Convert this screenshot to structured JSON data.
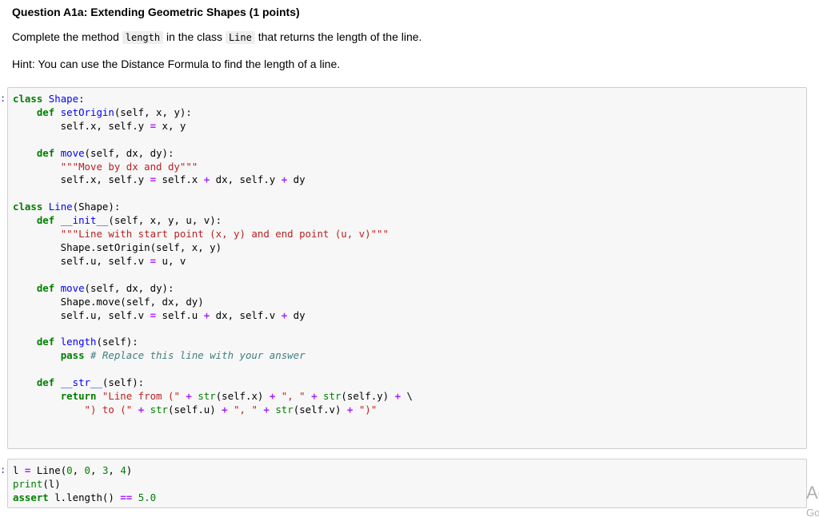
{
  "question": {
    "title": "Question A1a: Extending Geometric Shapes (1 points)",
    "instruction_prefix": "Complete the method ",
    "instruction_code1": "length",
    "instruction_middle": " in the class ",
    "instruction_code2": "Line",
    "instruction_suffix": " that returns the length of the line.",
    "hint": "Hint: You can use the Distance Formula to find the length of a line."
  },
  "cells": [
    {
      "prompt": ":",
      "lines": [
        [
          [
            "kw",
            "class"
          ],
          [
            "t",
            " "
          ],
          [
            "cls",
            "Shape"
          ],
          [
            "t",
            ":"
          ]
        ],
        [
          [
            "t",
            "    "
          ],
          [
            "kw",
            "def"
          ],
          [
            "t",
            " "
          ],
          [
            "fn",
            "setOrigin"
          ],
          [
            "t",
            "(self, x, y):"
          ]
        ],
        [
          [
            "t",
            "        self.x, self.y "
          ],
          [
            "op",
            "="
          ],
          [
            "t",
            " x, y"
          ]
        ],
        [
          [
            "t",
            ""
          ]
        ],
        [
          [
            "t",
            "    "
          ],
          [
            "kw",
            "def"
          ],
          [
            "t",
            " "
          ],
          [
            "fn",
            "move"
          ],
          [
            "t",
            "(self, dx, dy):"
          ]
        ],
        [
          [
            "t",
            "        "
          ],
          [
            "str",
            "\"\"\"Move by dx and dy\"\"\""
          ]
        ],
        [
          [
            "t",
            "        self.x, self.y "
          ],
          [
            "op",
            "="
          ],
          [
            "t",
            " self.x "
          ],
          [
            "op",
            "+"
          ],
          [
            "t",
            " dx, self.y "
          ],
          [
            "op",
            "+"
          ],
          [
            "t",
            " dy"
          ]
        ],
        [
          [
            "t",
            ""
          ]
        ],
        [
          [
            "kw",
            "class"
          ],
          [
            "t",
            " "
          ],
          [
            "cls",
            "Line"
          ],
          [
            "t",
            "(Shape):"
          ]
        ],
        [
          [
            "t",
            "    "
          ],
          [
            "kw",
            "def"
          ],
          [
            "t",
            " "
          ],
          [
            "fn",
            "__init__"
          ],
          [
            "t",
            "(self, x, y, u, v):"
          ]
        ],
        [
          [
            "t",
            "        "
          ],
          [
            "str",
            "\"\"\"Line with start point (x, y) and end point (u, v)\"\"\""
          ]
        ],
        [
          [
            "t",
            "        Shape.setOrigin(self, x, y)"
          ]
        ],
        [
          [
            "t",
            "        self.u, self.v "
          ],
          [
            "op",
            "="
          ],
          [
            "t",
            " u, v"
          ]
        ],
        [
          [
            "t",
            ""
          ]
        ],
        [
          [
            "t",
            "    "
          ],
          [
            "kw",
            "def"
          ],
          [
            "t",
            " "
          ],
          [
            "fn",
            "move"
          ],
          [
            "t",
            "(self, dx, dy):"
          ]
        ],
        [
          [
            "t",
            "        Shape.move(self, dx, dy)"
          ]
        ],
        [
          [
            "t",
            "        self.u, self.v "
          ],
          [
            "op",
            "="
          ],
          [
            "t",
            " self.u "
          ],
          [
            "op",
            "+"
          ],
          [
            "t",
            " dx, self.v "
          ],
          [
            "op",
            "+"
          ],
          [
            "t",
            " dy"
          ]
        ],
        [
          [
            "t",
            ""
          ]
        ],
        [
          [
            "t",
            "    "
          ],
          [
            "kw",
            "def"
          ],
          [
            "t",
            " "
          ],
          [
            "fn",
            "length"
          ],
          [
            "t",
            "(self):"
          ]
        ],
        [
          [
            "t",
            "        "
          ],
          [
            "kw",
            "pass"
          ],
          [
            "t",
            " "
          ],
          [
            "cm",
            "# Replace this line with your answer"
          ]
        ],
        [
          [
            "t",
            ""
          ]
        ],
        [
          [
            "t",
            "    "
          ],
          [
            "kw",
            "def"
          ],
          [
            "t",
            " "
          ],
          [
            "fn",
            "__str__"
          ],
          [
            "t",
            "(self):"
          ]
        ],
        [
          [
            "t",
            "        "
          ],
          [
            "kw",
            "return"
          ],
          [
            "t",
            " "
          ],
          [
            "str",
            "\"Line from (\""
          ],
          [
            "t",
            " "
          ],
          [
            "op",
            "+"
          ],
          [
            "t",
            " "
          ],
          [
            "bi",
            "str"
          ],
          [
            "t",
            "(self.x) "
          ],
          [
            "op",
            "+"
          ],
          [
            "t",
            " "
          ],
          [
            "str",
            "\", \""
          ],
          [
            "t",
            " "
          ],
          [
            "op",
            "+"
          ],
          [
            "t",
            " "
          ],
          [
            "bi",
            "str"
          ],
          [
            "t",
            "(self.y) "
          ],
          [
            "op",
            "+"
          ],
          [
            "t",
            " \\"
          ]
        ],
        [
          [
            "t",
            "            "
          ],
          [
            "str",
            "\") to (\""
          ],
          [
            "t",
            " "
          ],
          [
            "op",
            "+"
          ],
          [
            "t",
            " "
          ],
          [
            "bi",
            "str"
          ],
          [
            "t",
            "(self.u) "
          ],
          [
            "op",
            "+"
          ],
          [
            "t",
            " "
          ],
          [
            "str",
            "\", \""
          ],
          [
            "t",
            " "
          ],
          [
            "op",
            "+"
          ],
          [
            "t",
            " "
          ],
          [
            "bi",
            "str"
          ],
          [
            "t",
            "(self.v) "
          ],
          [
            "op",
            "+"
          ],
          [
            "t",
            " "
          ],
          [
            "str",
            "\")\""
          ]
        ]
      ]
    },
    {
      "prompt": ":",
      "lines": [
        [
          [
            "t",
            "l "
          ],
          [
            "op",
            "="
          ],
          [
            "t",
            " Line("
          ],
          [
            "num",
            "0"
          ],
          [
            "t",
            ", "
          ],
          [
            "num",
            "0"
          ],
          [
            "t",
            ", "
          ],
          [
            "num",
            "3"
          ],
          [
            "t",
            ", "
          ],
          [
            "num",
            "4"
          ],
          [
            "t",
            ")"
          ]
        ],
        [
          [
            "bi",
            "print"
          ],
          [
            "t",
            "(l)"
          ]
        ],
        [
          [
            "kw",
            "assert"
          ],
          [
            "t",
            " l.length() "
          ],
          [
            "op",
            "=="
          ],
          [
            "t",
            " "
          ],
          [
            "num",
            "5.0"
          ]
        ]
      ]
    }
  ],
  "watermark": {
    "line1": "Ac",
    "line2": "Go"
  }
}
